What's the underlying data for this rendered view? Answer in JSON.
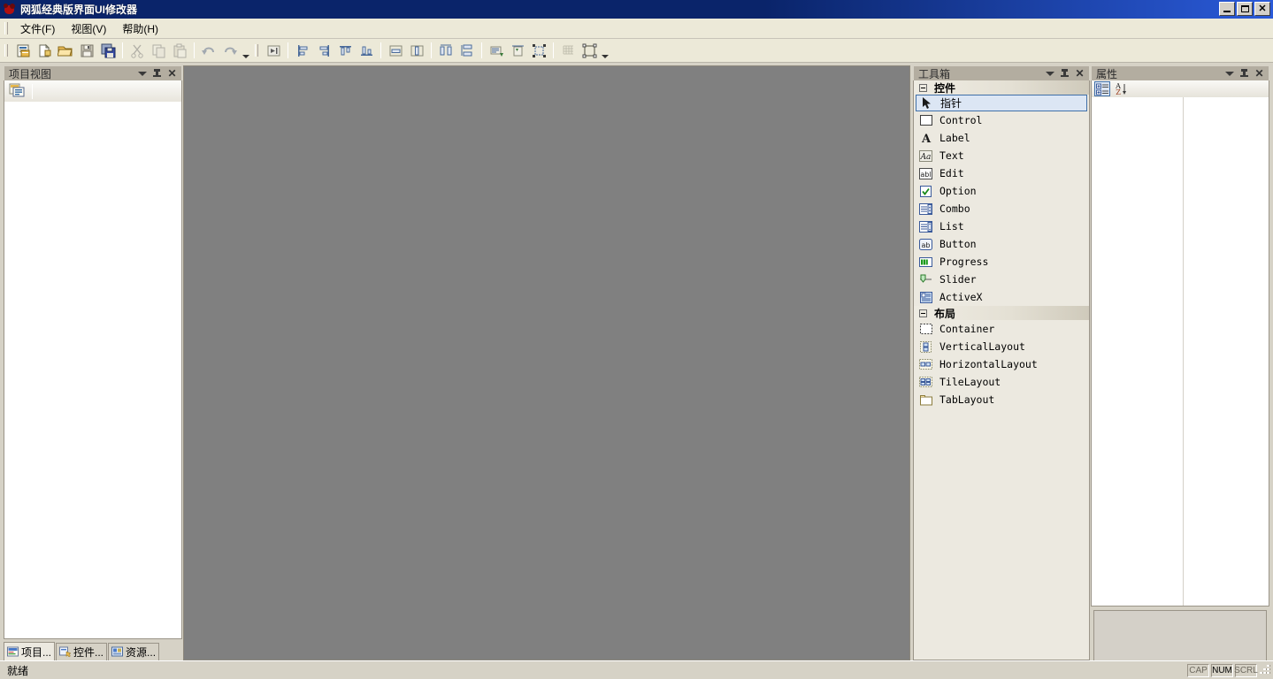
{
  "window": {
    "title": "网狐经典版界面UI修改器",
    "icon": "app-icon",
    "minimize_label": "",
    "maximize_label": "",
    "close_label": "✕"
  },
  "menu": {
    "items": [
      {
        "label": "文件(F)",
        "text": "文件",
        "accel": "F"
      },
      {
        "label": "视图(V)",
        "text": "视图",
        "accel": "V"
      },
      {
        "label": "帮助(H)",
        "text": "帮助",
        "accel": "H"
      }
    ]
  },
  "toolbar": {
    "groups": [
      {
        "buttons": [
          {
            "name": "new-project-button",
            "icon": "new-project-icon"
          },
          {
            "name": "new-file-button",
            "icon": "new-file-icon"
          },
          {
            "name": "open-button",
            "icon": "open-folder-icon"
          },
          {
            "name": "save-button",
            "icon": "save-disk-icon"
          },
          {
            "name": "save-all-button",
            "icon": "save-all-icon"
          }
        ]
      },
      {
        "buttons": [
          {
            "name": "cut-button",
            "icon": "scissors-icon"
          },
          {
            "name": "copy-button",
            "icon": "copy-icon"
          },
          {
            "name": "paste-button",
            "icon": "paste-icon"
          }
        ]
      },
      {
        "buttons": [
          {
            "name": "undo-button",
            "icon": "undo-arrow-icon"
          },
          {
            "name": "redo-button",
            "icon": "redo-arrow-icon"
          }
        ]
      },
      {
        "buttons": [
          {
            "name": "tab-order-button",
            "icon": "tab-order-icon"
          }
        ]
      },
      {
        "buttons": [
          {
            "name": "align-left-button",
            "icon": "align-left-icon"
          },
          {
            "name": "align-right-button",
            "icon": "align-right-icon"
          },
          {
            "name": "align-top-button",
            "icon": "align-top-icon"
          },
          {
            "name": "align-bottom-button",
            "icon": "align-bottom-icon"
          }
        ]
      },
      {
        "buttons": [
          {
            "name": "center-horizontally-button",
            "icon": "center-horizontal-icon"
          },
          {
            "name": "center-vertically-button",
            "icon": "center-vertical-icon"
          }
        ]
      },
      {
        "buttons": [
          {
            "name": "make-same-width-button",
            "icon": "same-width-icon"
          },
          {
            "name": "make-same-height-button",
            "icon": "same-height-icon"
          }
        ]
      },
      {
        "buttons": [
          {
            "name": "size-to-content-button",
            "icon": "size-to-content-icon"
          },
          {
            "name": "space-across-button",
            "icon": "space-across-icon"
          },
          {
            "name": "size-to-grid-button",
            "icon": "size-to-grid-icon"
          }
        ]
      },
      {
        "buttons": [
          {
            "name": "toggle-grid-button",
            "icon": "grid-icon"
          },
          {
            "name": "test-dialog-button",
            "icon": "test-dialog-icon"
          }
        ]
      }
    ],
    "overflow_label": "chevron-down-icon"
  },
  "project_view": {
    "title": "项目视图",
    "dropdown_icon": "chevron-down-icon",
    "pin_icon": "pin-icon",
    "close_icon": "close-icon",
    "toolbar": [
      {
        "name": "project-properties-button",
        "icon": "project-list-icon"
      }
    ],
    "tree_items": [],
    "tabs": [
      {
        "label": "项目...",
        "icon": "project-tab-icon",
        "active": true
      },
      {
        "label": "控件...",
        "icon": "control-tab-icon",
        "active": false
      },
      {
        "label": "资源...",
        "icon": "resource-tab-icon",
        "active": false
      }
    ]
  },
  "canvas": {
    "background": "#808080",
    "content": ""
  },
  "toolbox": {
    "title": "工具箱",
    "dropdown_icon": "chevron-down-icon",
    "pin_icon": "pin-icon",
    "close_icon": "close-icon",
    "sections": [
      {
        "title": "控件",
        "collapsed": false,
        "items": [
          {
            "label": "指针",
            "icon": "pointer-icon",
            "selected": true
          },
          {
            "label": "Control",
            "icon": "control-rect-icon",
            "selected": false
          },
          {
            "label": "Label",
            "icon": "label-A-icon",
            "selected": false
          },
          {
            "label": "Text",
            "icon": "text-Aa-icon",
            "selected": false
          },
          {
            "label": "Edit",
            "icon": "edit-abl-icon",
            "selected": false
          },
          {
            "label": "Option",
            "icon": "option-check-icon",
            "selected": false
          },
          {
            "label": "Combo",
            "icon": "combo-box-icon",
            "selected": false
          },
          {
            "label": "List",
            "icon": "list-box-icon",
            "selected": false
          },
          {
            "label": "Button",
            "icon": "button-ab-icon",
            "selected": false
          },
          {
            "label": "Progress",
            "icon": "progress-bar-icon",
            "selected": false
          },
          {
            "label": "Slider",
            "icon": "slider-icon",
            "selected": false
          },
          {
            "label": "ActiveX",
            "icon": "activex-icon",
            "selected": false
          }
        ]
      },
      {
        "title": "布局",
        "collapsed": false,
        "items": [
          {
            "label": "Container",
            "icon": "container-icon",
            "selected": false
          },
          {
            "label": "VerticalLayout",
            "icon": "vertical-layout-icon",
            "selected": false
          },
          {
            "label": "HorizontalLayout",
            "icon": "horizontal-layout-icon",
            "selected": false
          },
          {
            "label": "TileLayout",
            "icon": "tile-layout-icon",
            "selected": false
          },
          {
            "label": "TabLayout",
            "icon": "tab-layout-icon",
            "selected": false
          }
        ]
      }
    ]
  },
  "properties": {
    "title": "属性",
    "dropdown_icon": "chevron-down-icon",
    "pin_icon": "pin-icon",
    "close_icon": "close-icon",
    "toolbar": [
      {
        "name": "categorized-button",
        "icon": "categorized-icon",
        "pressed": true
      },
      {
        "name": "alphabetical-button",
        "icon": "sort-az-icon",
        "pressed": false
      }
    ],
    "rows": [],
    "description": ""
  },
  "statusbar": {
    "text": "就绪",
    "indicators": [
      {
        "label": "CAP",
        "active": false
      },
      {
        "label": "NUM",
        "active": true
      },
      {
        "label": "SCRL",
        "active": false
      }
    ]
  },
  "colors": {
    "titlebar_start": "#0a246a",
    "titlebar_end": "#2a5ad8",
    "panel_bg": "#d6d2c6",
    "panel_header": "#b3ada0",
    "canvas": "#808080",
    "selection": "#dce6f4",
    "selection_border": "#3f6fa8"
  }
}
